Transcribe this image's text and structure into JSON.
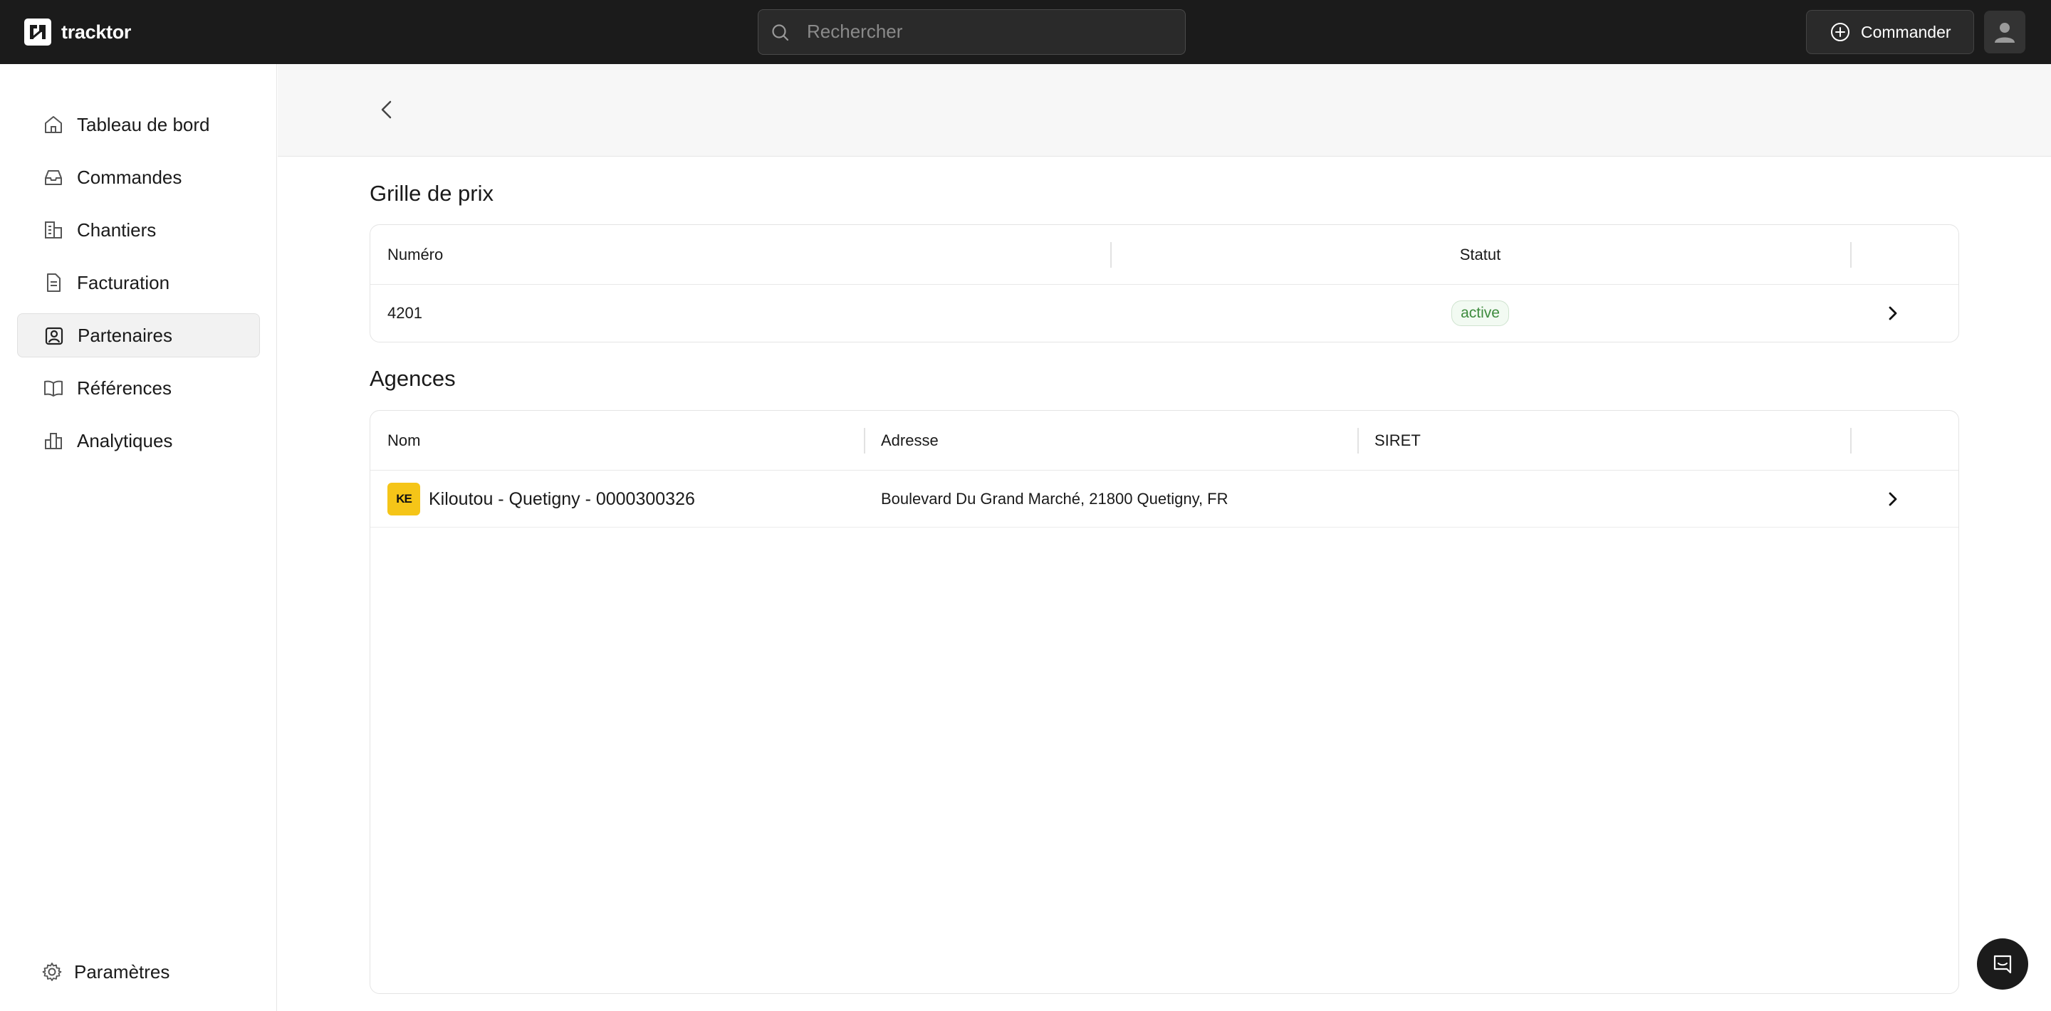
{
  "app": {
    "name": "tracktor"
  },
  "search": {
    "placeholder": "Rechercher",
    "value": ""
  },
  "header": {
    "order_button": "Commander"
  },
  "sidebar": {
    "items": [
      {
        "label": "Tableau de bord",
        "icon": "home-icon"
      },
      {
        "label": "Commandes",
        "icon": "inbox-icon"
      },
      {
        "label": "Chantiers",
        "icon": "building-icon"
      },
      {
        "label": "Facturation",
        "icon": "document-icon"
      },
      {
        "label": "Partenaires",
        "icon": "contact-icon",
        "active": true
      },
      {
        "label": "Références",
        "icon": "book-icon"
      },
      {
        "label": "Analytiques",
        "icon": "chart-icon"
      }
    ],
    "settings": "Paramètres"
  },
  "price_grid": {
    "title": "Grille de prix",
    "columns": [
      "Numéro",
      "Statut",
      ""
    ],
    "rows": [
      {
        "numero": "4201",
        "statut": "active"
      }
    ]
  },
  "agencies": {
    "title": "Agences",
    "columns": [
      "Nom",
      "Adresse",
      "SIRET",
      ""
    ],
    "rows": [
      {
        "logo_text": "KE",
        "nom": "Kiloutou - Quetigny - 0000300326",
        "adresse": "Boulevard Du Grand Marché, 21800 Quetigny, FR",
        "siret": ""
      }
    ]
  },
  "colors": {
    "topbar": "#1b1b1b",
    "badge_green": "#3d8b3d",
    "logo_yellow": "#f5c518"
  }
}
